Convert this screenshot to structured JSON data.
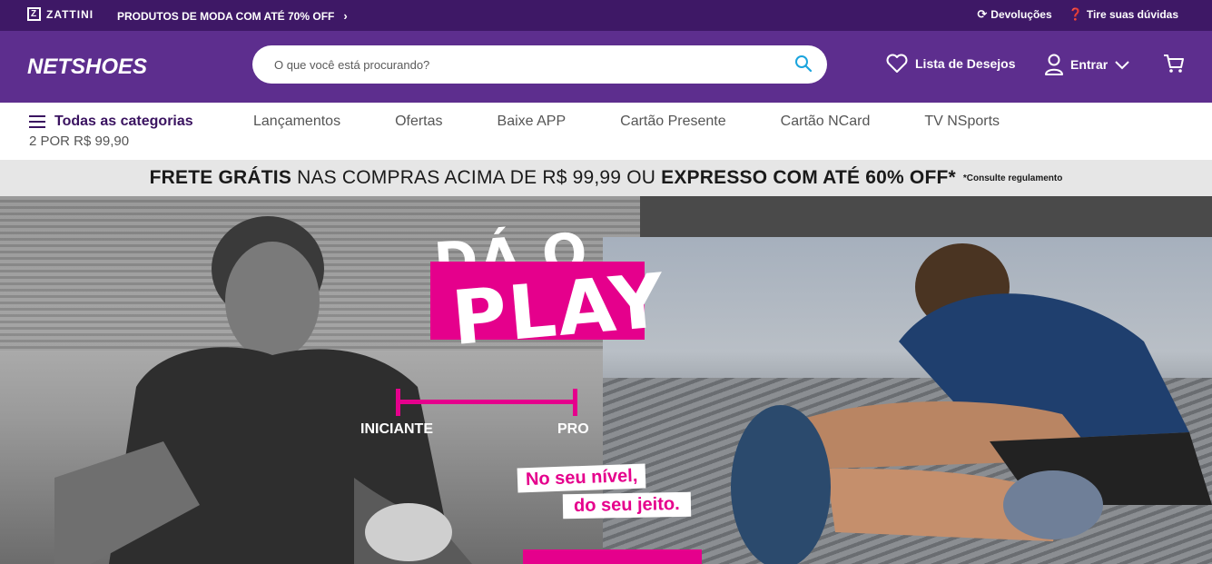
{
  "topbar": {
    "zattini_logo": "ZATTINI",
    "promo": "PRODUTOS DE MODA COM ATÉ 70% OFF",
    "returns": "Devoluções",
    "help": "Tire suas dúvidas"
  },
  "header": {
    "brand": "NETSHOES",
    "search_placeholder": "O que você está procurando?",
    "wishlist": "Lista de Desejos",
    "login": "Entrar"
  },
  "nav": {
    "all_categories": "Todas as categorias",
    "sub_promo": "2 POR R$ 99,90",
    "items": [
      "Lançamentos",
      "Ofertas",
      "Baixe APP",
      "Cartão Presente",
      "Cartão NCard",
      "TV NSports"
    ]
  },
  "shipping": {
    "part1_bold": "FRETE GRÁTIS",
    "part2": " NAS COMPRAS ACIMA DE R$ 99,99 OU ",
    "part3_bold": "EXPRESSO COM ATÉ 60% OFF*",
    "note": "*Consulte regulamento"
  },
  "hero": {
    "headline_top": "DÁ O",
    "headline_bottom": "PLAY",
    "level_left": "INICIANTE",
    "level_right": "PRO",
    "slogan_line1": "No seu nível,",
    "slogan_line2": "do seu jeito."
  },
  "colors": {
    "topbar": "#3e1866",
    "header": "#5d2e8e",
    "accent": "#e5008c"
  }
}
